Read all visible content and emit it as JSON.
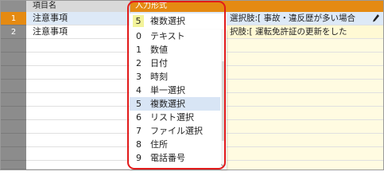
{
  "header": {
    "name_col": "項目名",
    "type_col": "入力形式"
  },
  "rows": [
    {
      "num": "1",
      "name": "注意事項",
      "value": "選択肢:[ 事故・違反歴が多い場合"
    },
    {
      "num": "2",
      "name": "注意事項",
      "value": "択肢:[ 運転免許証の更新をした"
    }
  ],
  "dropdown": {
    "selected_num": "5",
    "selected_label": "複数選択",
    "items": [
      {
        "num": "0",
        "label": "テキスト"
      },
      {
        "num": "1",
        "label": "数値"
      },
      {
        "num": "2",
        "label": "日付"
      },
      {
        "num": "3",
        "label": "時刻"
      },
      {
        "num": "4",
        "label": "単一選択"
      },
      {
        "num": "5",
        "label": "複数選択"
      },
      {
        "num": "6",
        "label": "リスト選択"
      },
      {
        "num": "7",
        "label": "ファイル選択"
      },
      {
        "num": "8",
        "label": "住所"
      },
      {
        "num": "9",
        "label": "電話番号"
      }
    ]
  },
  "colors": {
    "accent": "#e58a12",
    "highlight_outline": "#e21a1a",
    "row_selected": "#dde9f7",
    "input_bg": "#fff9d4"
  },
  "icons": [
    "pencil-icon",
    "chevron-down-icon"
  ]
}
